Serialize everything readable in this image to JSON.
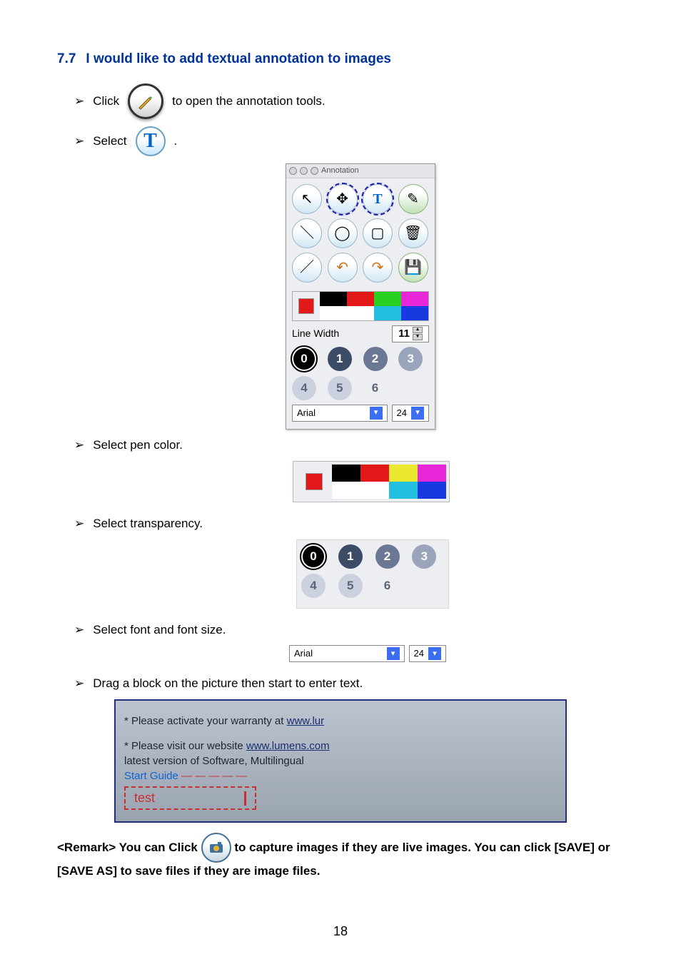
{
  "heading_num": "7.7",
  "heading_text": "I would like to add textual annotation to images",
  "steps": {
    "click_pre": "Click",
    "click_post": " to open the annotation tools.",
    "select_pre": "Select",
    "pen_color": "Select pen color.",
    "transparency": "Select transparency.",
    "font_size": "Select font and font size.",
    "drag": "Drag a block on the picture then start to enter text.",
    "period": "."
  },
  "panel": {
    "title": "Annotation",
    "linewidth_label": "Line Width",
    "linewidth_value": "11",
    "transparency_values": [
      "0",
      "1",
      "2",
      "3",
      "4",
      "5",
      "6"
    ],
    "font_name": "Arial",
    "font_size": "24"
  },
  "example": {
    "line1_pre": "* Please activate your warranty at  ",
    "line1_link": "www.lur",
    "line2_pre": "* Please visit our website ",
    "line2_link": "www.lumens.com",
    "line2_post": "latest  version  of  Software,  Multilingual",
    "start_guide": "Start Guide",
    "typed": "test"
  },
  "remark": {
    "pre": "<Remark> You can Click",
    "post": " to capture images if they are live images. You can click [SAVE] or [SAVE AS] to save files if they are image files."
  },
  "page_number": "18"
}
